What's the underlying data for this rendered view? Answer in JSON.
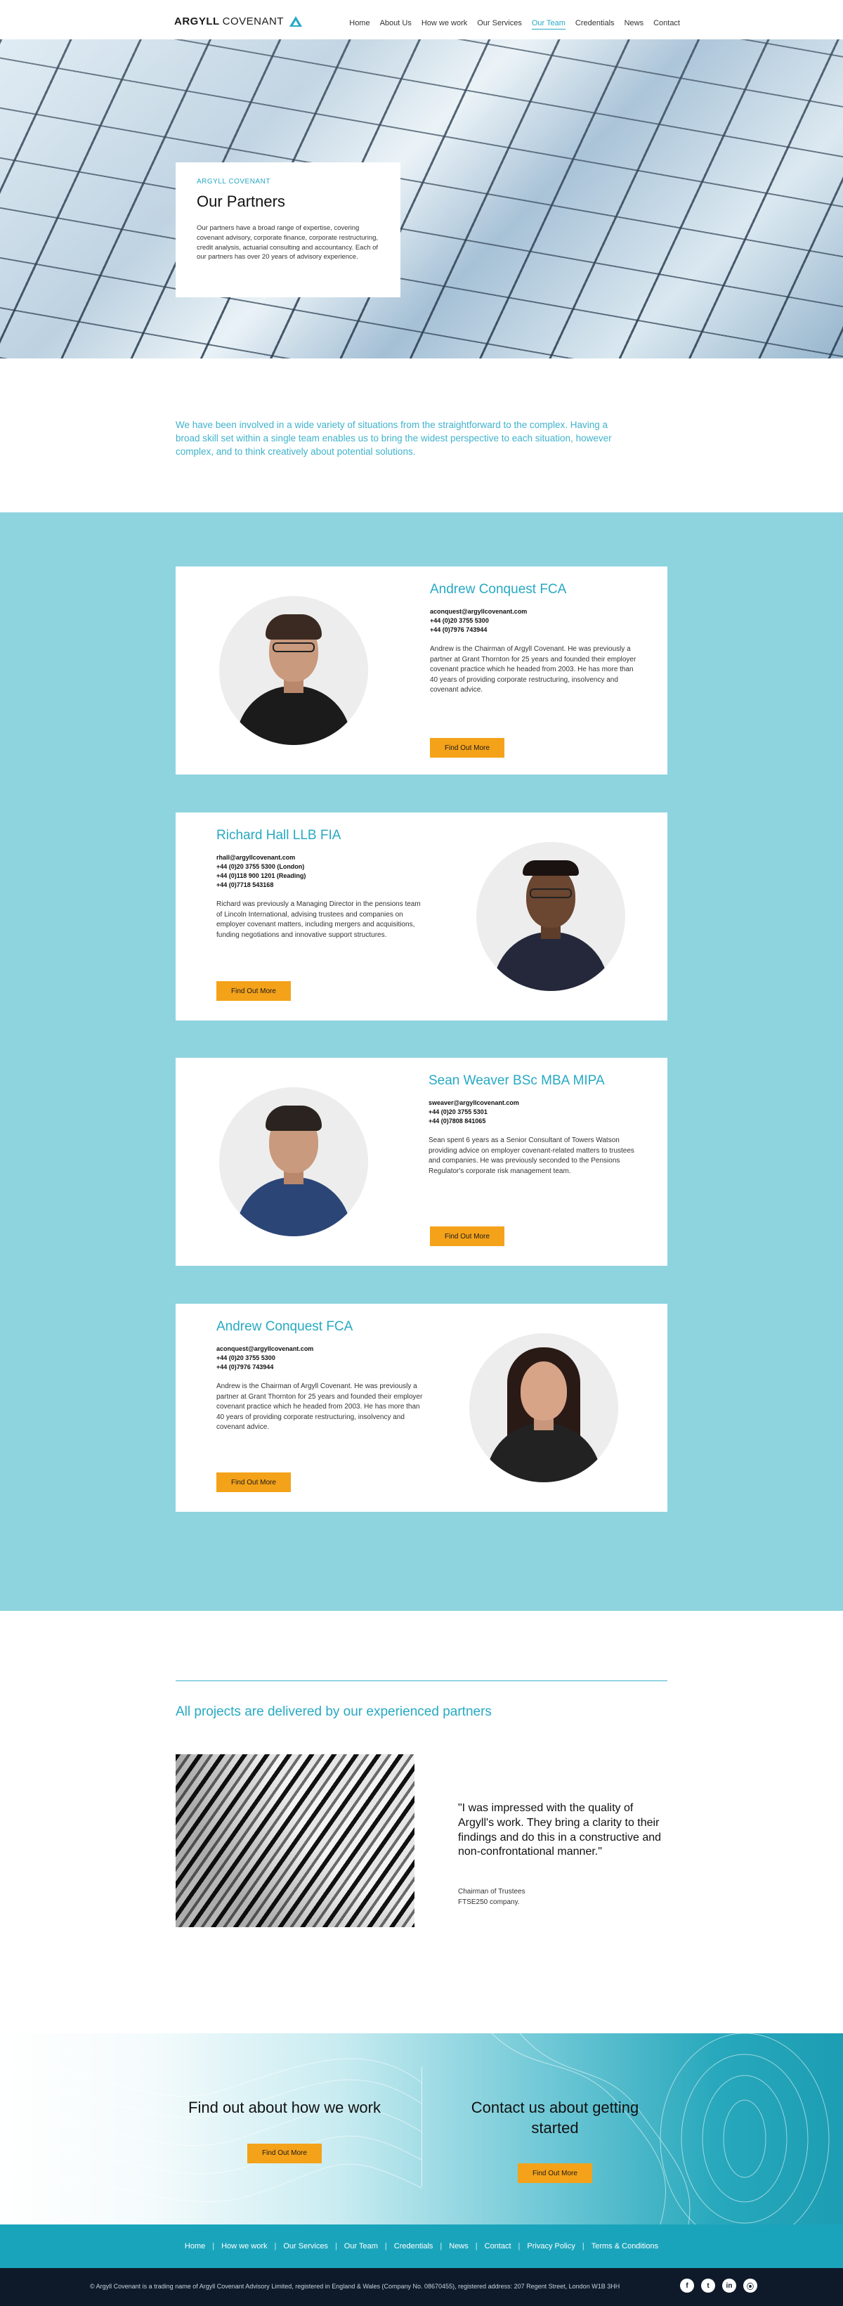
{
  "header": {
    "logo_bold": "ARGYLL",
    "logo_light": "COVENANT",
    "nav": [
      "Home",
      "About Us",
      "How we work",
      "Our Services",
      "Our Team",
      "Credentials",
      "News",
      "Contact"
    ],
    "active_nav": "Our Team"
  },
  "hero": {
    "eyebrow": "ARGYLL COVENANT",
    "title": "Our Partners",
    "text": "Our partners have a broad range of expertise, covering covenant advisory, corporate finance, corporate restructuring, credit analysis, actuarial consulting and accountancy.  Each of our partners has over 20 years of advisory experience."
  },
  "intro": "We have been involved in a wide variety of situations from the straightforward to the complex. Having a broad skill set within a single team enables us to bring the widest perspective to each situation, however complex, and to think creatively about potential solutions.",
  "members": [
    {
      "name": "Andrew Conquest FCA",
      "email": "aconquest@argyllcovenant.com",
      "phone1": "+44 (0)20 3755 5300",
      "phone2": "+44 (0)7976 743944",
      "phone3": "",
      "bio": "Andrew is the Chairman of Argyll Covenant.  He was previously a partner at Grant Thornton for 25 years and founded their employer covenant practice which he headed from 2003.  He has more than 40 years of providing corporate restructuring, insolvency and covenant advice.",
      "button": "Find Out More"
    },
    {
      "name": "Richard Hall LLB FIA",
      "email": "rhall@argyllcovenant.com",
      "phone1": "+44 (0)20 3755 5300 (London)",
      "phone2": "+44 (0)118 900 1201 (Reading)",
      "phone3": "+44 (0)7718 543168",
      "bio": "Richard was previously a Managing Director in the pensions team of Lincoln International, advising trustees and companies on employer covenant matters, including mergers and acquisitions, funding negotiations and innovative support structures.",
      "button": "Find Out More"
    },
    {
      "name": "Sean Weaver BSc MBA MIPA",
      "email": "sweaver@argyllcovenant.com",
      "phone1": "+44 (0)20 3755 5301",
      "phone2": "+44 (0)7808 841065",
      "phone3": "",
      "bio": "Sean spent 6 years as a Senior Consultant of Towers Watson providing advice on employer covenant-related matters to trustees and companies. He was previously seconded to the Pensions Regulator's corporate risk management team.",
      "button": "Find Out More"
    },
    {
      "name": "Andrew Conquest FCA",
      "email": "aconquest@argyllcovenant.com",
      "phone1": "+44 (0)20 3755 5300",
      "phone2": "+44 (0)7976 743944",
      "phone3": "",
      "bio": "Andrew is the Chairman of Argyll Covenant.  He was previously a partner at Grant Thornton for 25 years and founded their employer covenant practice which he headed from 2003.  He has more than 40 years of providing corporate restructuring, insolvency and covenant advice.",
      "button": "Find Out More"
    }
  ],
  "projects": {
    "title": "All projects are delivered by our experienced partners",
    "quote": "\"I was impressed with the quality of Argyll's work. They bring a clarity to their findings and do this in a constructive and non-confrontational manner.\"",
    "by1": "Chairman of Trustees",
    "by2": "FTSE250 company."
  },
  "cta": {
    "left_title": "Find out about how we work",
    "left_button": "Find Out More",
    "right_title": "Contact us about getting started",
    "right_button": "Find Out More"
  },
  "footer": {
    "links": [
      "Home",
      "How we work",
      "Our Services",
      "Our Team",
      "Credentials",
      "News",
      "Contact",
      "Privacy Policy",
      "Terms & Conditions"
    ],
    "copyright": "© Argyll Covenant is a trading name of Argyll Covenant Advisory Limited, registered in England & Wales (Company No. 08670455), registered address: 207 Regent Street, London W1B 3HH",
    "social_icons": [
      "facebook-icon",
      "twitter-icon",
      "linkedin-icon",
      "rss-icon"
    ]
  },
  "colors": {
    "accent": "#27a9c3",
    "band": "#8ed4df",
    "button": "#f4a21a",
    "footer_nav": "#1aa4bb",
    "footer_bar": "#0e1a2a"
  }
}
